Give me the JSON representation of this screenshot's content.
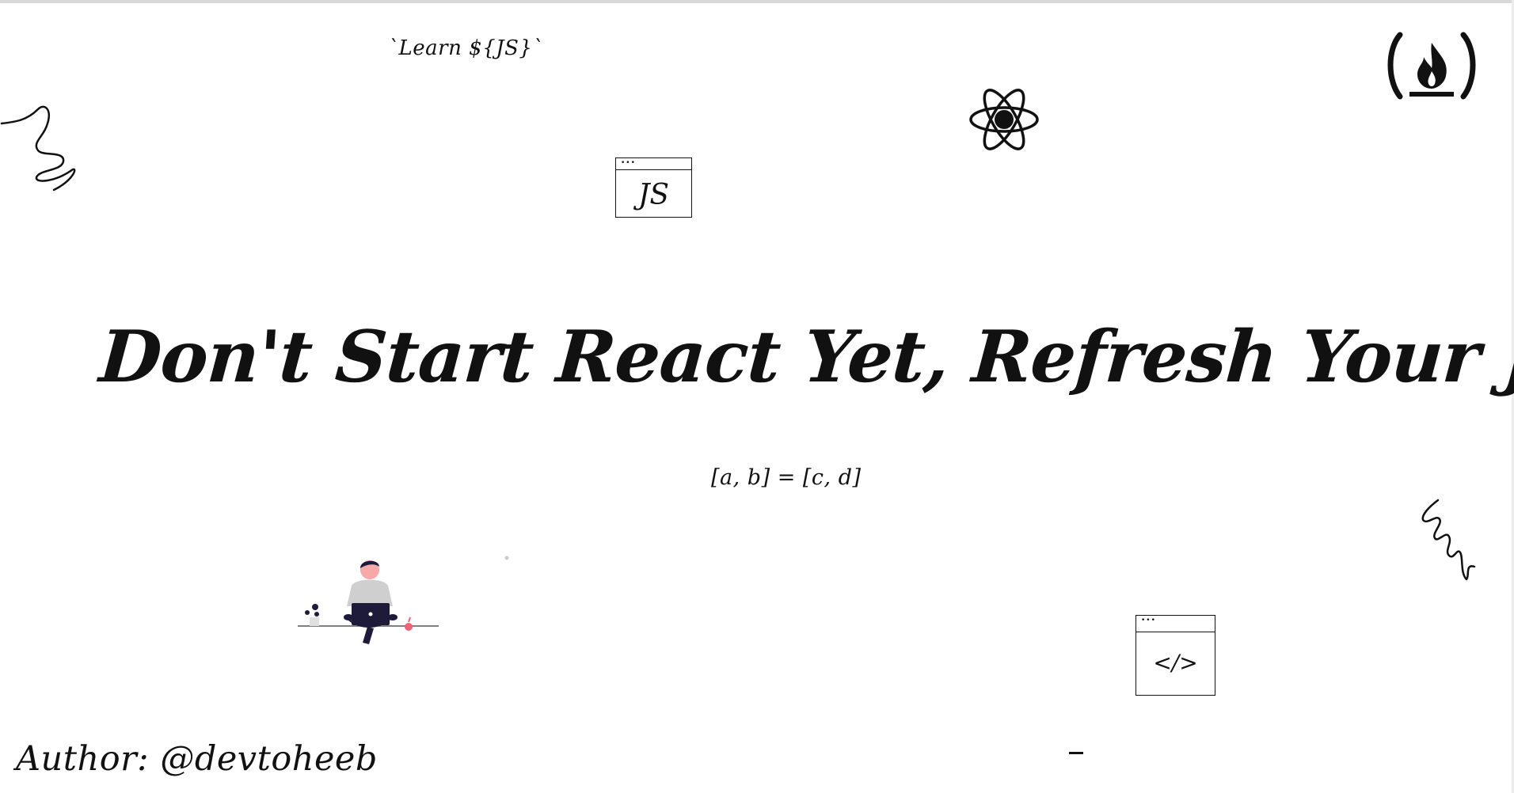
{
  "learn_tag": "`Learn ${JS}`",
  "title": "Don't Start React Yet, Refresh Your JavaScript",
  "destructure_expr": "[a, b] = [c, d]",
  "js_window_label": "JS",
  "code_window_label": "</>",
  "window_dots": "•••",
  "author": "Author: @devtoheeb",
  "colors": {
    "ink": "#111111",
    "laptop": "#1e1a3a",
    "shirt": "#cfcfcf",
    "skin": "#f7a8a8",
    "apple": "#f06377",
    "background": "#ffffff"
  },
  "icons": [
    "freecodecamp-logo-icon",
    "react-atom-icon",
    "person-with-laptop-illustration",
    "squiggle-icon"
  ]
}
